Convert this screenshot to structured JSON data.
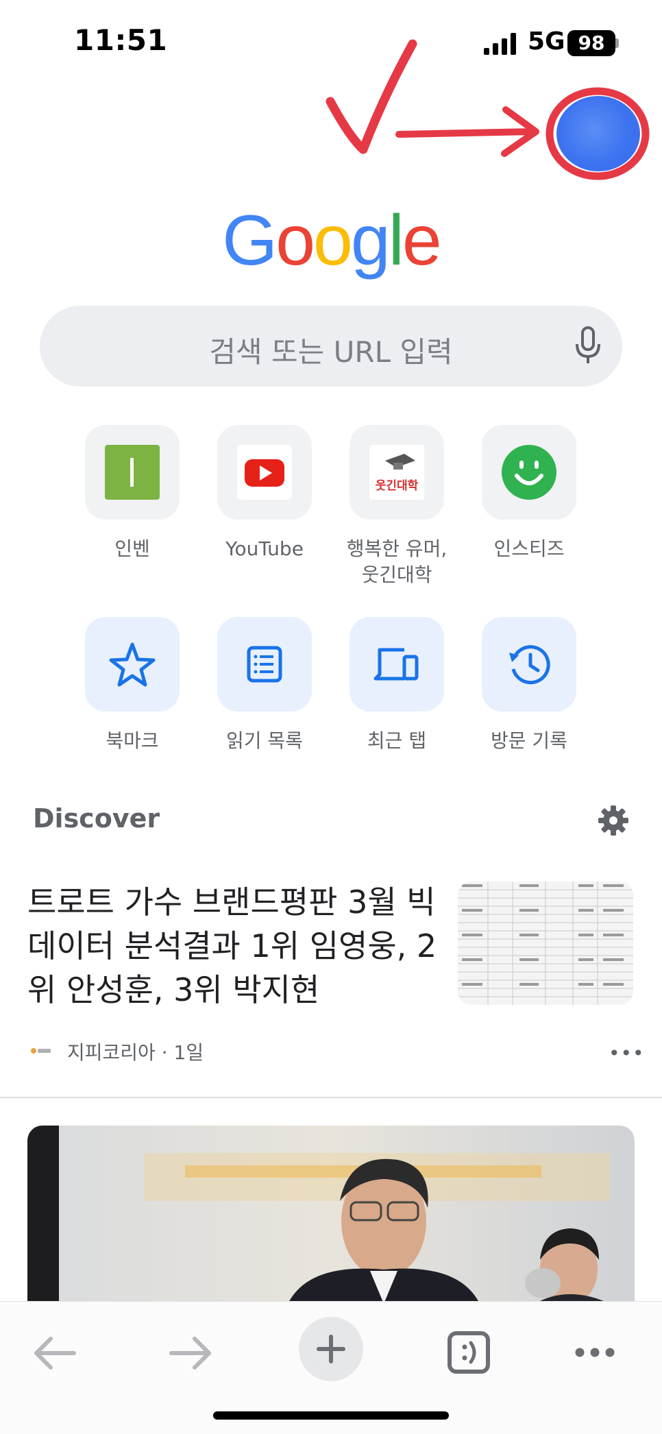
{
  "status_bar": {
    "time": "11:51",
    "network": "5G",
    "battery": "98"
  },
  "google_logo": [
    "G",
    "o",
    "o",
    "g",
    "l",
    "e"
  ],
  "logo_colors": [
    "#4285F4",
    "#EA4335",
    "#FBBC05",
    "#4285F4",
    "#34A853",
    "#EA4335"
  ],
  "search": {
    "placeholder": "검색 또는 URL 입력"
  },
  "shortcuts": [
    {
      "label": "인벤",
      "icon": "inven-icon"
    },
    {
      "label": "YouTube",
      "icon": "youtube-icon"
    },
    {
      "label": "행복한 유머,\n웃긴대학",
      "icon": "humoruniv-icon",
      "logo_text": "웃긴대학"
    },
    {
      "label": "인스티즈",
      "icon": "instiz-icon"
    }
  ],
  "utilities": [
    {
      "label": "북마크",
      "icon": "star-icon"
    },
    {
      "label": "읽기 목록",
      "icon": "reading-list-icon"
    },
    {
      "label": "최근 탭",
      "icon": "devices-icon"
    },
    {
      "label": "방문 기록",
      "icon": "history-icon"
    }
  ],
  "discover": {
    "title": "Discover",
    "article": {
      "headline": "트로트 가수 브랜드평판 3월 빅데이터 분석결과 1위 임영웅, 2위 안성훈, 3위 박지현",
      "source": "지피코리아 · 1일",
      "more": "•••"
    }
  },
  "colors": {
    "annotation_red": "#E63946",
    "accent_blue": "#1A73E8",
    "avatar_blue": "#3D73F0"
  }
}
